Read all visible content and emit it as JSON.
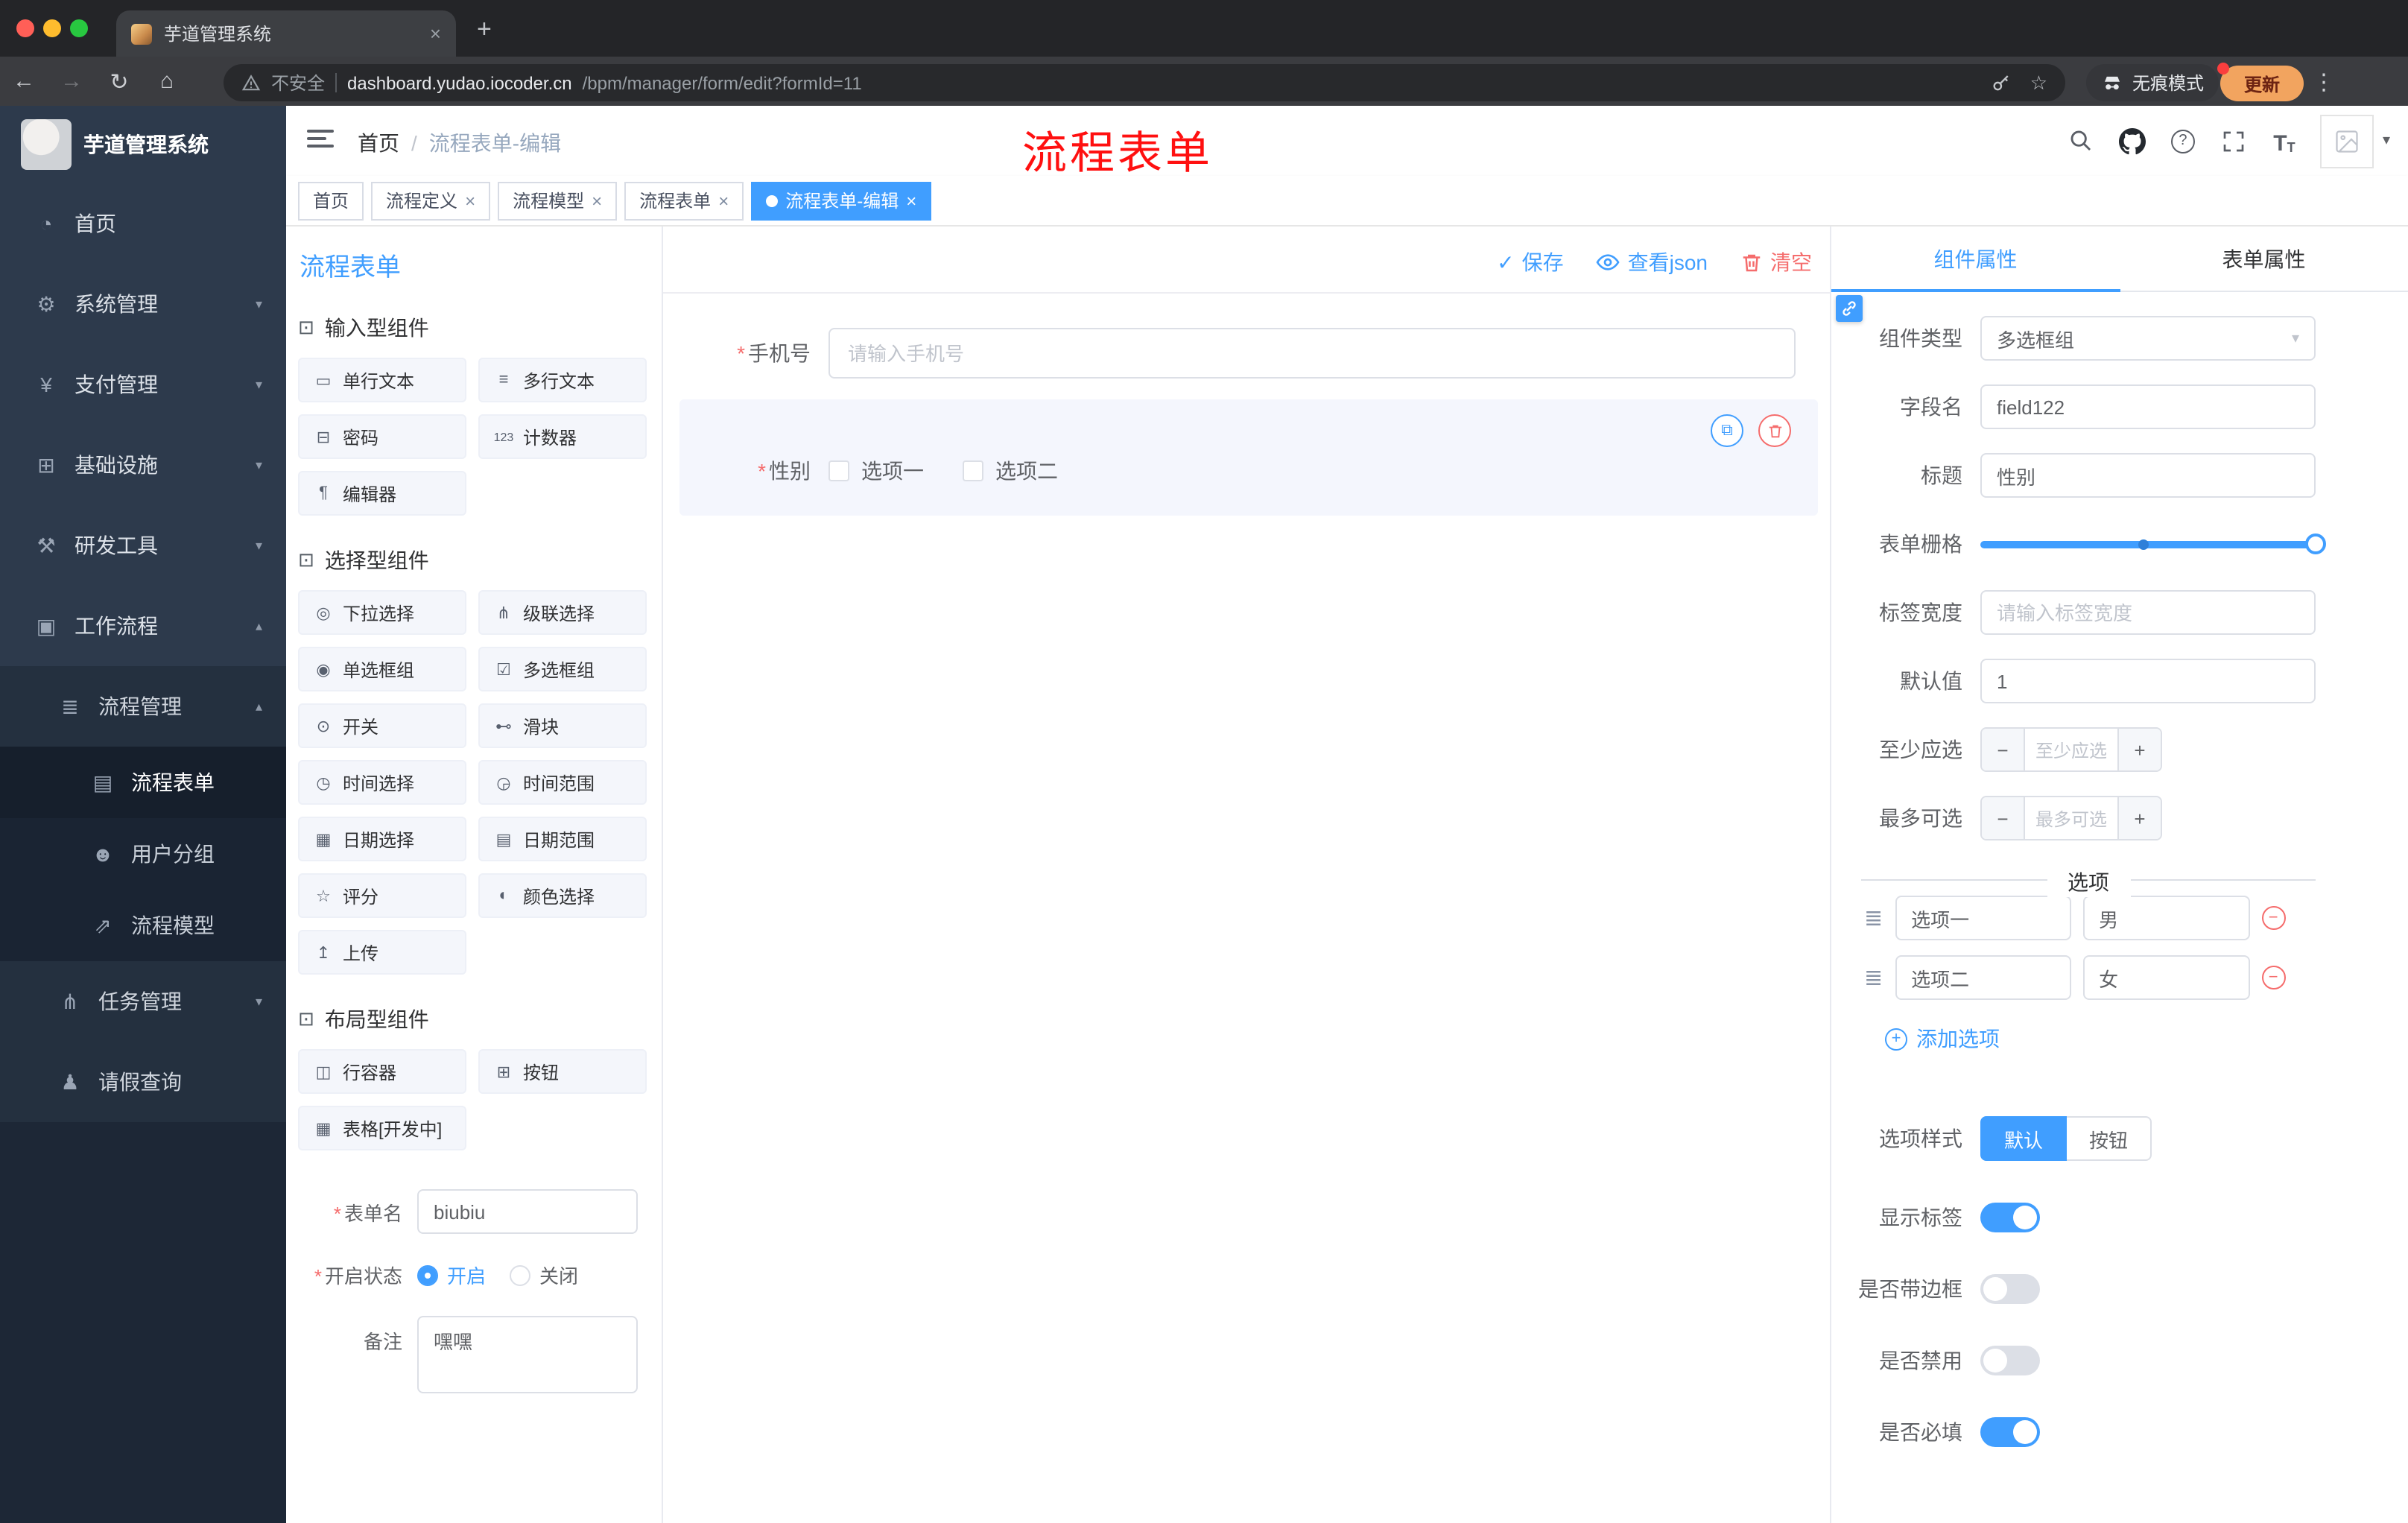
{
  "browser": {
    "tab_title": "芋道管理系统",
    "security_label": "不安全",
    "url_host": "dashboard.yudao.iocoder.cn",
    "url_path": "/bpm/manager/form/edit?formId=11",
    "incognito_label": "无痕模式",
    "update_label": "更新"
  },
  "glyphs": {
    "back": "←",
    "forward": "→",
    "reload": "↻",
    "home": "⌂",
    "star": "☆",
    "new_tab": "+",
    "close": "×",
    "menu_dots": "⋮",
    "chevron_down": "▾",
    "check": "✓",
    "minus": "−",
    "plus": "+",
    "dot": "●",
    "copy": "⧉",
    "help": "?",
    "font_size_large": "T",
    "font_size_small": "T",
    "breadcrumb_sep": "/",
    "drag_option": "≣",
    "asterisk": "*"
  },
  "colors": {
    "accent": "#409eff",
    "danger": "#f56c6c",
    "annotation": "#ff1010"
  },
  "sidebar": {
    "logo_title": "芋道管理系统",
    "items": [
      {
        "icon": "◔",
        "label": "首页"
      },
      {
        "icon": "⚙",
        "label": "系统管理",
        "chevron": "▾"
      },
      {
        "icon": "¥",
        "label": "支付管理",
        "chevron": "▾"
      },
      {
        "icon": "⊞",
        "label": "基础设施",
        "chevron": "▾"
      },
      {
        "icon": "⚒",
        "label": "研发工具",
        "chevron": "▾"
      },
      {
        "icon": "▣",
        "label": "工作流程",
        "chevron": "▴"
      }
    ],
    "process_mgmt": {
      "icon": "≣",
      "label": "流程管理",
      "chevron": "▴"
    },
    "process_children": [
      {
        "icon": "▤",
        "label": "流程表单"
      },
      {
        "icon": "☻",
        "label": "用户分组"
      },
      {
        "icon": "⇗",
        "label": "流程模型"
      }
    ],
    "task_mgmt": {
      "icon": "⋔",
      "label": "任务管理",
      "chevron": "▾"
    },
    "leave_query": {
      "icon": "♟",
      "label": "请假查询"
    }
  },
  "header": {
    "breadcrumb_home": "首页",
    "breadcrumb_current": "流程表单-编辑",
    "annotation": "流程表单"
  },
  "tags_view": [
    {
      "label": "首页"
    },
    {
      "label": "流程定义"
    },
    {
      "label": "流程模型"
    },
    {
      "label": "流程表单"
    },
    {
      "label": "流程表单-编辑"
    }
  ],
  "designer": {
    "title": "流程表单",
    "actions": {
      "save": "保存",
      "view_json": "查看json",
      "clear": "清空"
    },
    "palette": {
      "sections": [
        {
          "icon": "⊡",
          "title": "输入型组件",
          "items": [
            {
              "icon": "▭",
              "label": "单行文本"
            },
            {
              "icon": "≡",
              "label": "多行文本"
            },
            {
              "icon": "⊟",
              "label": "密码"
            },
            {
              "icon": "123",
              "label": "计数器"
            },
            {
              "icon": "¶",
              "label": "编辑器"
            }
          ]
        },
        {
          "icon": "⊡",
          "title": "选择型组件",
          "items": [
            {
              "icon": "◎",
              "label": "下拉选择"
            },
            {
              "icon": "⋔",
              "label": "级联选择"
            },
            {
              "icon": "◉",
              "label": "单选框组"
            },
            {
              "icon": "☑",
              "label": "多选框组"
            },
            {
              "icon": "⊙",
              "label": "开关"
            },
            {
              "icon": "⊷",
              "label": "滑块"
            },
            {
              "icon": "◷",
              "label": "时间选择"
            },
            {
              "icon": "◶",
              "label": "时间范围"
            },
            {
              "icon": "▦",
              "label": "日期选择"
            },
            {
              "icon": "▤",
              "label": "日期范围"
            },
            {
              "icon": "☆",
              "label": "评分"
            },
            {
              "icon": "◐",
              "label": "颜色选择"
            },
            {
              "icon": "↥",
              "label": "上传"
            }
          ]
        },
        {
          "icon": "⊡",
          "title": "布局型组件",
          "items": [
            {
              "icon": "◫",
              "label": "行容器"
            },
            {
              "icon": "⊞",
              "label": "按钮"
            },
            {
              "icon": "▦",
              "label": "表格[开发中]"
            }
          ]
        }
      ]
    },
    "meta": {
      "name_label": "表单名",
      "name_value": "biubiu",
      "status_label": "开启状态",
      "status_on": "开启",
      "status_off": "关闭",
      "remark_label": "备注",
      "remark_value": "嘿嘿"
    },
    "canvas": {
      "phone_label": "手机号",
      "phone_placeholder": "请输入手机号",
      "gender_label": "性别",
      "gender_opt1": "选项一",
      "gender_opt2": "选项二"
    },
    "props": {
      "tab_component": "组件属性",
      "tab_form": "表单属性",
      "component_type_label": "组件类型",
      "component_type_value": "多选框组",
      "field_name_label": "字段名",
      "field_name_value": "field122",
      "title_label": "标题",
      "title_value": "性别",
      "grid_label": "表单栅格",
      "label_width_label": "标签宽度",
      "label_width_placeholder": "请输入标签宽度",
      "default_label": "默认值",
      "default_value": "1",
      "min_label": "至少应选",
      "min_placeholder": "至少应选",
      "max_label": "最多可选",
      "max_placeholder": "最多可选",
      "options_title": "选项",
      "options": [
        {
          "label": "选项一",
          "value": "男"
        },
        {
          "label": "选项二",
          "value": "女"
        }
      ],
      "add_option": "添加选项",
      "style_label": "选项样式",
      "style_default": "默认",
      "style_button": "按钮",
      "show_label_label": "显示标签",
      "border_label": "是否带边框",
      "disabled_label": "是否禁用",
      "required_label": "是否必填"
    }
  }
}
